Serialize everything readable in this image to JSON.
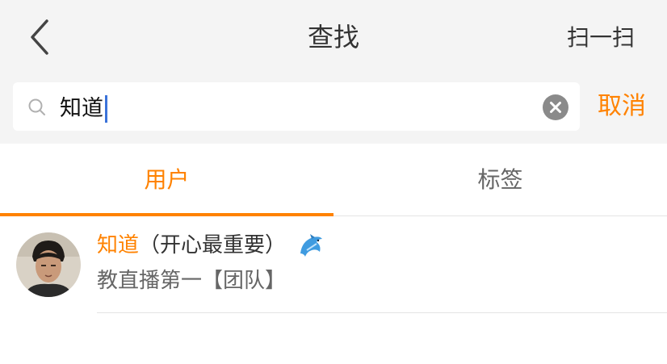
{
  "header": {
    "title": "查找",
    "scan_label": "扫一扫",
    "back_icon": "chevron-left-icon"
  },
  "search": {
    "query": "知道",
    "cancel_label": "取消",
    "search_icon": "search-icon",
    "clear_icon": "clear-icon"
  },
  "tabs": [
    {
      "label": "用户",
      "active": true
    },
    {
      "label": "标签",
      "active": false
    }
  ],
  "results": [
    {
      "name_highlight": "知道",
      "name_rest": "（开心最重要）",
      "emoji_icon": "dolphin-icon",
      "description": "教直播第一【团队】"
    }
  ],
  "colors": {
    "accent": "#ff8200",
    "header_bg": "#f4f4f4",
    "text_primary": "#333333",
    "text_secondary": "#666666",
    "caret": "#3b73d9"
  }
}
